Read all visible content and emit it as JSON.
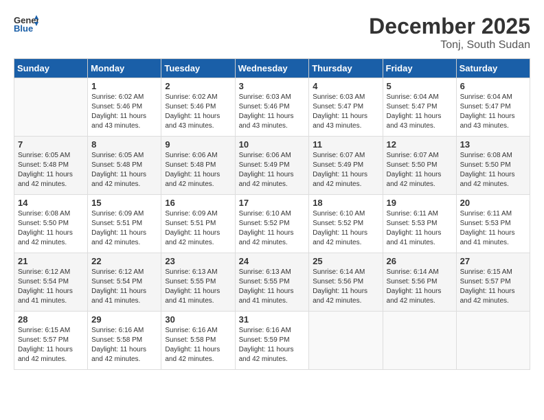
{
  "header": {
    "logo_line1": "General",
    "logo_line2": "Blue",
    "month_year": "December 2025",
    "location": "Tonj, South Sudan"
  },
  "weekdays": [
    "Sunday",
    "Monday",
    "Tuesday",
    "Wednesday",
    "Thursday",
    "Friday",
    "Saturday"
  ],
  "weeks": [
    [
      {
        "day": "",
        "sunrise": "",
        "sunset": "",
        "daylight": ""
      },
      {
        "day": "1",
        "sunrise": "6:02 AM",
        "sunset": "5:46 PM",
        "daylight": "11 hours and 43 minutes."
      },
      {
        "day": "2",
        "sunrise": "6:02 AM",
        "sunset": "5:46 PM",
        "daylight": "11 hours and 43 minutes."
      },
      {
        "day": "3",
        "sunrise": "6:03 AM",
        "sunset": "5:46 PM",
        "daylight": "11 hours and 43 minutes."
      },
      {
        "day": "4",
        "sunrise": "6:03 AM",
        "sunset": "5:47 PM",
        "daylight": "11 hours and 43 minutes."
      },
      {
        "day": "5",
        "sunrise": "6:04 AM",
        "sunset": "5:47 PM",
        "daylight": "11 hours and 43 minutes."
      },
      {
        "day": "6",
        "sunrise": "6:04 AM",
        "sunset": "5:47 PM",
        "daylight": "11 hours and 43 minutes."
      }
    ],
    [
      {
        "day": "7",
        "sunrise": "6:05 AM",
        "sunset": "5:48 PM",
        "daylight": "11 hours and 42 minutes."
      },
      {
        "day": "8",
        "sunrise": "6:05 AM",
        "sunset": "5:48 PM",
        "daylight": "11 hours and 42 minutes."
      },
      {
        "day": "9",
        "sunrise": "6:06 AM",
        "sunset": "5:48 PM",
        "daylight": "11 hours and 42 minutes."
      },
      {
        "day": "10",
        "sunrise": "6:06 AM",
        "sunset": "5:49 PM",
        "daylight": "11 hours and 42 minutes."
      },
      {
        "day": "11",
        "sunrise": "6:07 AM",
        "sunset": "5:49 PM",
        "daylight": "11 hours and 42 minutes."
      },
      {
        "day": "12",
        "sunrise": "6:07 AM",
        "sunset": "5:50 PM",
        "daylight": "11 hours and 42 minutes."
      },
      {
        "day": "13",
        "sunrise": "6:08 AM",
        "sunset": "5:50 PM",
        "daylight": "11 hours and 42 minutes."
      }
    ],
    [
      {
        "day": "14",
        "sunrise": "6:08 AM",
        "sunset": "5:50 PM",
        "daylight": "11 hours and 42 minutes."
      },
      {
        "day": "15",
        "sunrise": "6:09 AM",
        "sunset": "5:51 PM",
        "daylight": "11 hours and 42 minutes."
      },
      {
        "day": "16",
        "sunrise": "6:09 AM",
        "sunset": "5:51 PM",
        "daylight": "11 hours and 42 minutes."
      },
      {
        "day": "17",
        "sunrise": "6:10 AM",
        "sunset": "5:52 PM",
        "daylight": "11 hours and 42 minutes."
      },
      {
        "day": "18",
        "sunrise": "6:10 AM",
        "sunset": "5:52 PM",
        "daylight": "11 hours and 42 minutes."
      },
      {
        "day": "19",
        "sunrise": "6:11 AM",
        "sunset": "5:53 PM",
        "daylight": "11 hours and 41 minutes."
      },
      {
        "day": "20",
        "sunrise": "6:11 AM",
        "sunset": "5:53 PM",
        "daylight": "11 hours and 41 minutes."
      }
    ],
    [
      {
        "day": "21",
        "sunrise": "6:12 AM",
        "sunset": "5:54 PM",
        "daylight": "11 hours and 41 minutes."
      },
      {
        "day": "22",
        "sunrise": "6:12 AM",
        "sunset": "5:54 PM",
        "daylight": "11 hours and 41 minutes."
      },
      {
        "day": "23",
        "sunrise": "6:13 AM",
        "sunset": "5:55 PM",
        "daylight": "11 hours and 41 minutes."
      },
      {
        "day": "24",
        "sunrise": "6:13 AM",
        "sunset": "5:55 PM",
        "daylight": "11 hours and 41 minutes."
      },
      {
        "day": "25",
        "sunrise": "6:14 AM",
        "sunset": "5:56 PM",
        "daylight": "11 hours and 42 minutes."
      },
      {
        "day": "26",
        "sunrise": "6:14 AM",
        "sunset": "5:56 PM",
        "daylight": "11 hours and 42 minutes."
      },
      {
        "day": "27",
        "sunrise": "6:15 AM",
        "sunset": "5:57 PM",
        "daylight": "11 hours and 42 minutes."
      }
    ],
    [
      {
        "day": "28",
        "sunrise": "6:15 AM",
        "sunset": "5:57 PM",
        "daylight": "11 hours and 42 minutes."
      },
      {
        "day": "29",
        "sunrise": "6:16 AM",
        "sunset": "5:58 PM",
        "daylight": "11 hours and 42 minutes."
      },
      {
        "day": "30",
        "sunrise": "6:16 AM",
        "sunset": "5:58 PM",
        "daylight": "11 hours and 42 minutes."
      },
      {
        "day": "31",
        "sunrise": "6:16 AM",
        "sunset": "5:59 PM",
        "daylight": "11 hours and 42 minutes."
      },
      {
        "day": "",
        "sunrise": "",
        "sunset": "",
        "daylight": ""
      },
      {
        "day": "",
        "sunrise": "",
        "sunset": "",
        "daylight": ""
      },
      {
        "day": "",
        "sunrise": "",
        "sunset": "",
        "daylight": ""
      }
    ]
  ],
  "labels": {
    "sunrise_prefix": "Sunrise: ",
    "sunset_prefix": "Sunset: ",
    "daylight_prefix": "Daylight: "
  }
}
